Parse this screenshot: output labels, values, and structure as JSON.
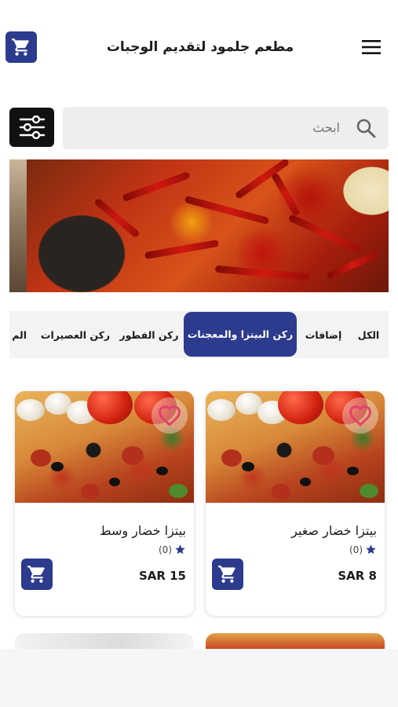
{
  "header": {
    "title": "مطعم جلمود لتقديم الوجبات",
    "cart_icon": "cart-icon",
    "menu_icon": "menu-icon"
  },
  "search": {
    "placeholder": "ابحث",
    "icon": "search-icon",
    "filter_icon": "sliders-icon"
  },
  "tabs": [
    {
      "label": "الكل",
      "active": false
    },
    {
      "label": "إضافات",
      "active": false
    },
    {
      "label": "ركن البيتزا والمعجنات",
      "active": true
    },
    {
      "label": "ركن الفطور",
      "active": false
    },
    {
      "label": "ركن العصيرات",
      "active": false
    },
    {
      "label": "الم",
      "active": false
    }
  ],
  "products": [
    {
      "name": "بيتزا خضار صغير",
      "rating_count": "(0)",
      "price": "SAR 8"
    },
    {
      "name": "بيتزا خضار وسط",
      "rating_count": "(0)",
      "price": "SAR 15"
    }
  ],
  "colors": {
    "primary": "#2d3b8e",
    "filter_button": "#111111",
    "search_bg": "#eeeeee",
    "heart": "#e0436b",
    "star": "#2d3b8e"
  }
}
